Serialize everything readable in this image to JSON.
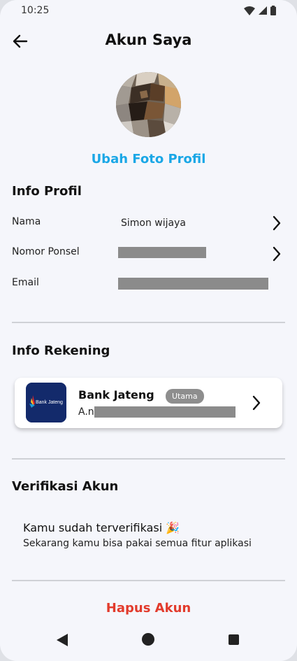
{
  "status_bar": {
    "time": "10:25",
    "icons": [
      "wifi-icon",
      "signal-icon",
      "battery-icon"
    ]
  },
  "header": {
    "title": "Akun Saya",
    "back_icon": "arrow-left-icon"
  },
  "profile": {
    "change_photo_label": "Ubah Foto Profil"
  },
  "info_profil": {
    "title": "Info Profil",
    "fields": [
      {
        "label": "Nama",
        "value": "Simon wijaya",
        "editable": true
      },
      {
        "label": "Nomor Ponsel",
        "value": "",
        "editable": true,
        "redacted": true
      },
      {
        "label": "Email",
        "value": "",
        "editable": false,
        "redacted": true
      }
    ]
  },
  "info_rekening": {
    "title": "Info Rekening",
    "bank": {
      "name": "Bank Jateng",
      "badge": "Utama",
      "account_prefix": "A.n",
      "logo_text": "Bank Jateng"
    }
  },
  "verifikasi": {
    "title": "Verifikasi Akun",
    "line1": "Kamu sudah terverifikasi 🎉",
    "line2": "Sekarang kamu bisa pakai semua fitur aplikasi"
  },
  "delete_account_label": "Hapus Akun",
  "colors": {
    "accent_blue": "#1aa7e6",
    "danger_red": "#e23b2c",
    "background": "#f5f6fb",
    "bank_logo_bg": "#132a6b"
  },
  "nav_bar": {
    "icons": [
      "nav-back-icon",
      "nav-home-icon",
      "nav-recents-icon"
    ]
  }
}
